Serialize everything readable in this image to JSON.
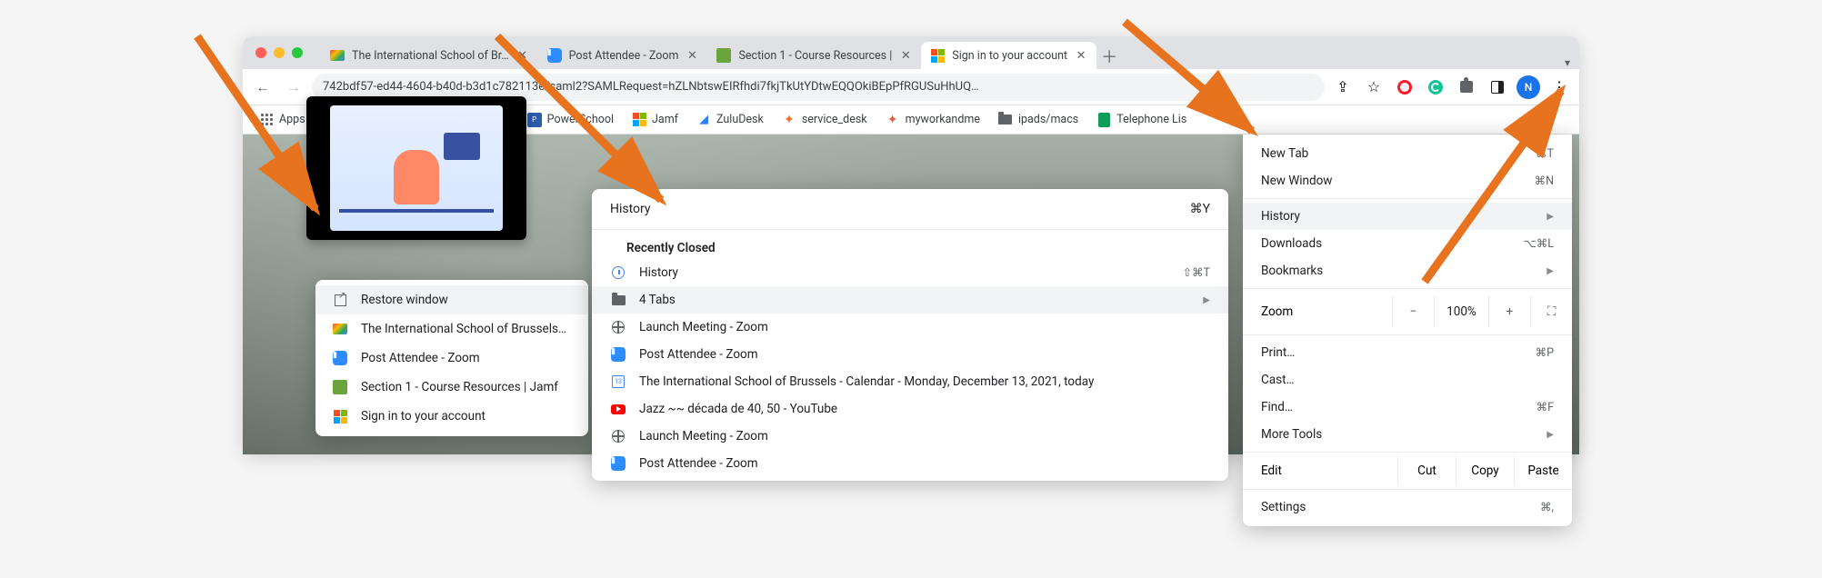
{
  "tabs": [
    {
      "label": "The International School of Br…",
      "favicon": "gmail"
    },
    {
      "label": "Post Attendee - Zoom",
      "favicon": "zoom"
    },
    {
      "label": "Section 1 - Course Resources |",
      "favicon": "jamf"
    },
    {
      "label": "Sign in to your account",
      "favicon": "ms",
      "active": true
    }
  ],
  "omnibox": "742bdf57-ed44-4604-b40d-b3d1c782113e/saml2?SAMLRequest=hZLNbtswEIRfhdi7fkjTkUtYDtwEQQOkiBEpPfRGUSuHhUQ…",
  "bookmarks": {
    "apps": "Apps",
    "items": [
      {
        "label": "PowerSchool",
        "icon": "ps"
      },
      {
        "label": "Jamf",
        "icon": "ms"
      },
      {
        "label": "ZuluDesk",
        "icon": "zulu"
      },
      {
        "label": "service_desk",
        "icon": "sd"
      },
      {
        "label": "myworkandme",
        "icon": "mwm"
      },
      {
        "label": "ipads/macs",
        "icon": "folder"
      },
      {
        "label": "Telephone Lis",
        "icon": "sheets"
      }
    ]
  },
  "left_menu": {
    "restore": "Restore window",
    "items": [
      {
        "label": "The International School of Brussels…",
        "icon": "gmail"
      },
      {
        "label": "Post Attendee - Zoom",
        "icon": "zoom"
      },
      {
        "label": "Section 1 - Course Resources | Jamf",
        "icon": "jamf"
      },
      {
        "label": "Sign in to your account",
        "icon": "ms"
      }
    ]
  },
  "center_menu": {
    "title": "History",
    "title_shortcut": "⌘Y",
    "section": "Recently Closed",
    "history_row": {
      "label": "History",
      "shortcut": "⇧⌘T"
    },
    "tabs_row": "4 Tabs",
    "items": [
      {
        "label": "Launch Meeting - Zoom",
        "icon": "globe"
      },
      {
        "label": "Post Attendee - Zoom",
        "icon": "zoom"
      },
      {
        "label": "The International School of Brussels - Calendar - Monday, December 13, 2021, today",
        "icon": "cal"
      },
      {
        "label": "Jazz ~~ década de 40, 50 - YouTube",
        "icon": "yt"
      },
      {
        "label": "Launch Meeting - Zoom",
        "icon": "globe"
      },
      {
        "label": "Post Attendee - Zoom",
        "icon": "zoom"
      }
    ]
  },
  "right_menu": {
    "new_tab": {
      "label": "New Tab",
      "shortcut": "⌘T"
    },
    "new_window": {
      "label": "New Window",
      "shortcut": "⌘N"
    },
    "history": "History",
    "downloads": {
      "label": "Downloads",
      "shortcut": "⌥⌘L"
    },
    "bookmarks": "Bookmarks",
    "zoom": {
      "label": "Zoom",
      "value": "100%"
    },
    "print": {
      "label": "Print…",
      "shortcut": "⌘P"
    },
    "cast": "Cast…",
    "find": {
      "label": "Find…",
      "shortcut": "⌘F"
    },
    "more_tools": "More Tools",
    "edit": {
      "label": "Edit",
      "cut": "Cut",
      "copy": "Copy",
      "paste": "Paste"
    },
    "settings": {
      "label": "Settings",
      "shortcut": "⌘,"
    }
  },
  "avatar_letter": "N",
  "cal_day": "13"
}
